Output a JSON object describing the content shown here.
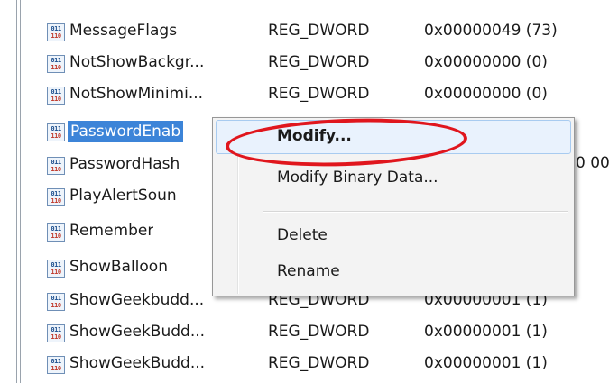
{
  "registry": {
    "rows": [
      {
        "name": "MessageFlags",
        "type": "REG_DWORD",
        "data": "0x00000049 (73)"
      },
      {
        "name": "NotShowBackgr...",
        "type": "REG_DWORD",
        "data": "0x00000000 (0)"
      },
      {
        "name": "NotShowMinimi...",
        "type": "REG_DWORD",
        "data": "0x00000000 (0)"
      },
      {
        "name": "PasswordEnab",
        "type": "",
        "data": "",
        "selected": true
      },
      {
        "name": "PasswordHash",
        "type": "",
        "data": ""
      },
      {
        "name": "PlayAlertSoun",
        "type": "",
        "data": ""
      },
      {
        "name": "Remember",
        "type": "",
        "data": ""
      },
      {
        "name": "ShowBalloon",
        "type": "",
        "data": ""
      },
      {
        "name": "ShowGeekbudd...",
        "type": "REG_DWORD",
        "data": "0x00000001 (1)"
      },
      {
        "name": "ShowGeekBudd...",
        "type": "REG_DWORD",
        "data": "0x00000001 (1)"
      },
      {
        "name": "ShowGeekBudd...",
        "type": "REG_DWORD",
        "data": "0x00000001 (1)"
      }
    ],
    "overflow_data": "0 00",
    "icon_text_top": "011",
    "icon_text_bottom": "110"
  },
  "context_menu": {
    "items": [
      {
        "label": "Modify...",
        "highlighted": true
      },
      {
        "label": "Modify Binary Data..."
      },
      {
        "label": "Delete"
      },
      {
        "label": "Rename"
      }
    ]
  },
  "annotation": {
    "color": "#e0161d",
    "shape": "ellipse"
  }
}
